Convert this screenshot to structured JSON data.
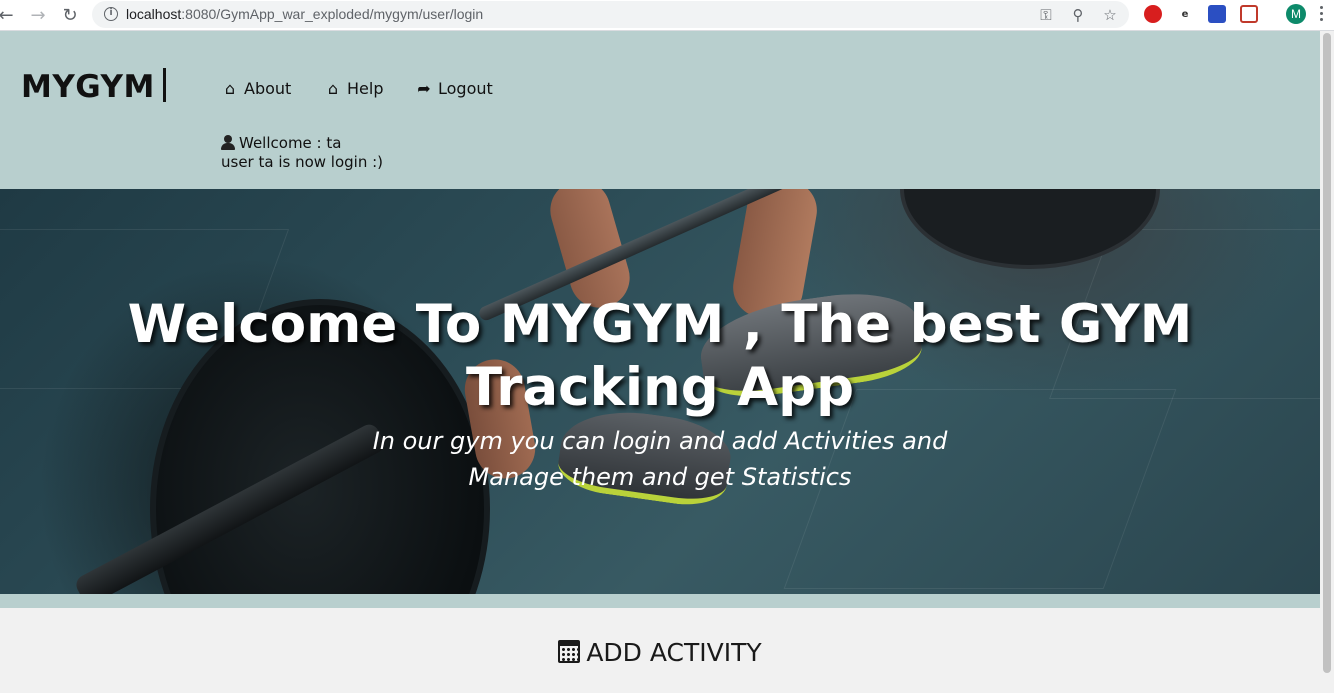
{
  "browser": {
    "url_host": "localhost",
    "url_rest": ":8080/GymApp_war_exploded/mygym/user/login",
    "profile_initial": "M",
    "nav_back": "←",
    "nav_forward": "→",
    "nav_reload": "↻",
    "info_glyph": "i",
    "key_glyph": "⚿",
    "zoom_glyph": "⚲",
    "star_glyph": "☆"
  },
  "site": {
    "logo": "MYGYM",
    "nav": [
      {
        "label": "About",
        "icon": "home-icon",
        "glyph": "⌂"
      },
      {
        "label": "Help",
        "icon": "home-icon",
        "glyph": "⌂"
      },
      {
        "label": "Logout",
        "icon": "sign-out-icon",
        "glyph": "➦"
      }
    ],
    "welcome_line": "Wellcome : ta",
    "login_status": "user ta is now login :)"
  },
  "hero": {
    "title": "Welcome To MYGYM , The best GYM Tracking App",
    "subtitle_line1": "In our gym you can login and add Activities and",
    "subtitle_line2": "Manage them and get Statistics"
  },
  "section": {
    "title": "ADD ACTIVITY",
    "icon": "calendar-icon"
  },
  "colors": {
    "page_bg": "#b8cfce",
    "section_bg": "#f1f1f1",
    "avatar": "#0d8a6a",
    "accent_shoe": "#b9d23a"
  }
}
